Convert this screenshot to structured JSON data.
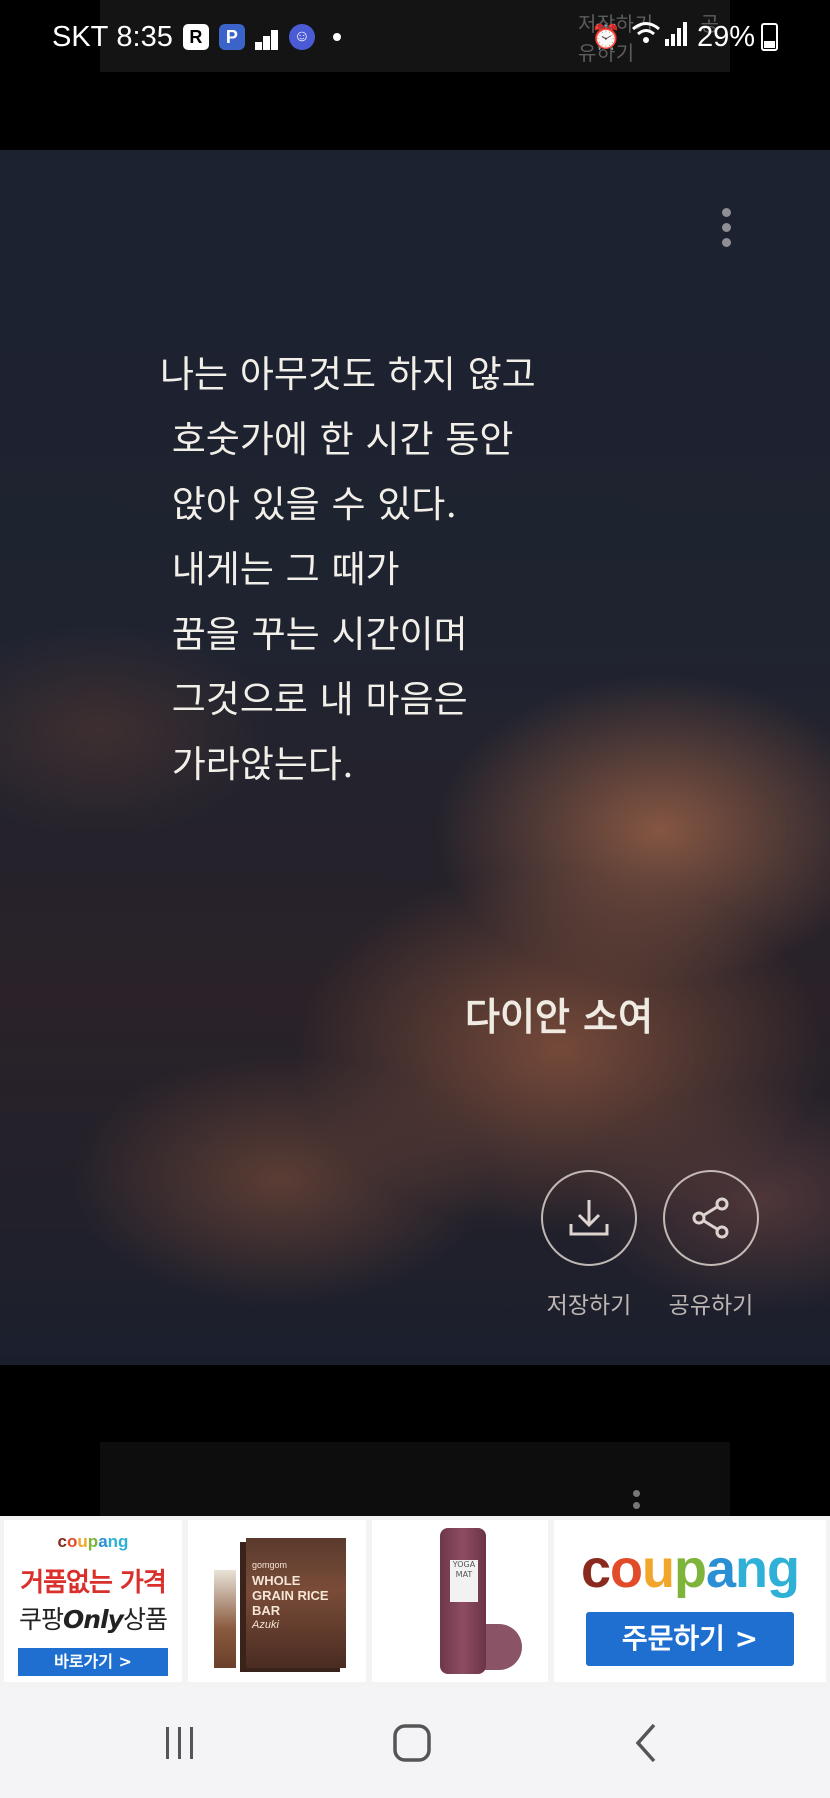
{
  "status_bar": {
    "carrier": "SKT",
    "time": "8:35",
    "battery": "29%",
    "icons": [
      "r-app-icon",
      "p-app-icon",
      "bars-app-icon",
      "face-app-icon",
      "notification-dot",
      "alarm-icon",
      "wifi-icon",
      "signal-icon",
      "battery-icon"
    ]
  },
  "ghost_bar": {
    "save_label": "저장하기",
    "share_label": "공유하기"
  },
  "card": {
    "quote": "나는 아무것도 하지 않고\n 호숫가에 한 시간 동안\n 앉아 있을 수 있다.\n 내게는 그 때가\n 꿈을 꾸는 시간이며\n 그것으로 내 마음은\n 가라앉는다.",
    "author": "다이안 소여",
    "save_label": "저장하기",
    "share_label": "공유하기"
  },
  "ad": {
    "cell1": {
      "logo": "coupang",
      "headline": "거품없는 가격",
      "sub_prefix": "쿠팡",
      "sub_only": "Only",
      "sub_suffix": "상품",
      "button": "바로가기 >"
    },
    "cell2": {
      "brand": "gomgom",
      "title": "WHOLE GRAIN RICE BAR",
      "flavor": "Azuki"
    },
    "cell3": {
      "label": "YOGA MAT"
    },
    "cell4": {
      "logo": "coupang",
      "button": "주문하기 >"
    }
  },
  "navbar": {
    "icons": [
      "recent-apps-icon",
      "home-icon",
      "back-icon"
    ]
  }
}
